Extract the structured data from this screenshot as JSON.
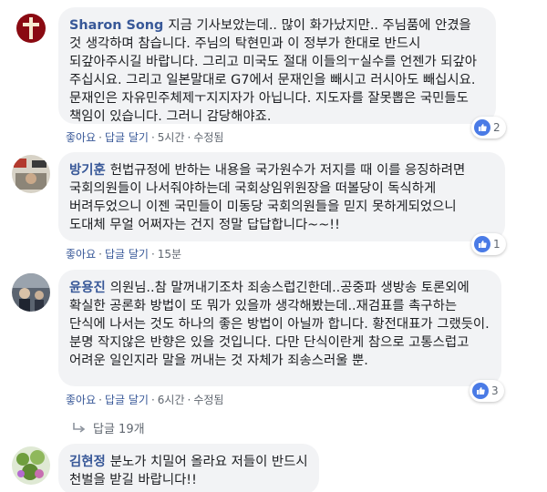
{
  "comments": [
    {
      "author": "Sharon Song",
      "text": "지금 기사보았는데.. 많이 화가났지만.. 주님품에 안겼을 것 생각하며 참습니다. 주님의 탁현민과 이 정부가 한대로 반드시 되갚아주시길 바랍니다. 그리고 미국도 절대 이들의ㅜ실수를 언젠가 되갚아 주십시요. 그리고 일본말대로 G7에서 문재인을 빼시고 러시아도 빼십시요. 문재인은 자유민주체제ㅜ지지자가 아닙니다. 지도자를 잘못뽑은 국민들도 책임이 있습니다. 그러니 감당해야죠.",
      "like": "좋아요",
      "reply": "답글 달기",
      "time": "5시간",
      "edited": "수정됨",
      "reaction_count": "2"
    },
    {
      "author": "방기훈",
      "text": "헌법규정에 반하는 내용을 국가원수가 저지를 때 이를 응징하려면 국회의원들이 나서줘야하는데 국회상임위원장을 떠볼당이 독식하게 버려두었으니 이젠 국민들이 미동당 국회의원들을 믿지 못하게되었으니 도대체 무얼 어쩌자는 건지 정말 답답합니다~~!!",
      "like": "좋아요",
      "reply": "답글 달기",
      "time": "15분",
      "reaction_count": "1"
    },
    {
      "author": "윤용진",
      "text": "의원님..참 말꺼내기조차 죄송스럽긴한데..공중파 생방송 토론외에 확실한 공론화 방법이 또 뭐가 있을까 생각해봤는데..재검표를 촉구하는 단식에 나서는 것도 하나의 좋은 방법이 아닐까 합니다. 황전대표가 그랬듯이. 분명 작지않은 반향은 있을 것입니다. 다만 단식이란게 참으로 고통스럽고 어려운 일인지라 말을 꺼내는 것 자체가 죄송스러울 뿐.",
      "like": "좋아요",
      "reply": "답글 달기",
      "time": "6시간",
      "edited": "수정됨",
      "reaction_count": "3",
      "replies_label": "답글 19개"
    },
    {
      "author": "김현정",
      "text": "분노가 치밀어 올라요 저들이 반드시 천벌을 받길 바랍니다!!"
    }
  ],
  "colors": {
    "link": "#385898",
    "bubble": "#f2f3f5",
    "like": "#4a7be6"
  }
}
